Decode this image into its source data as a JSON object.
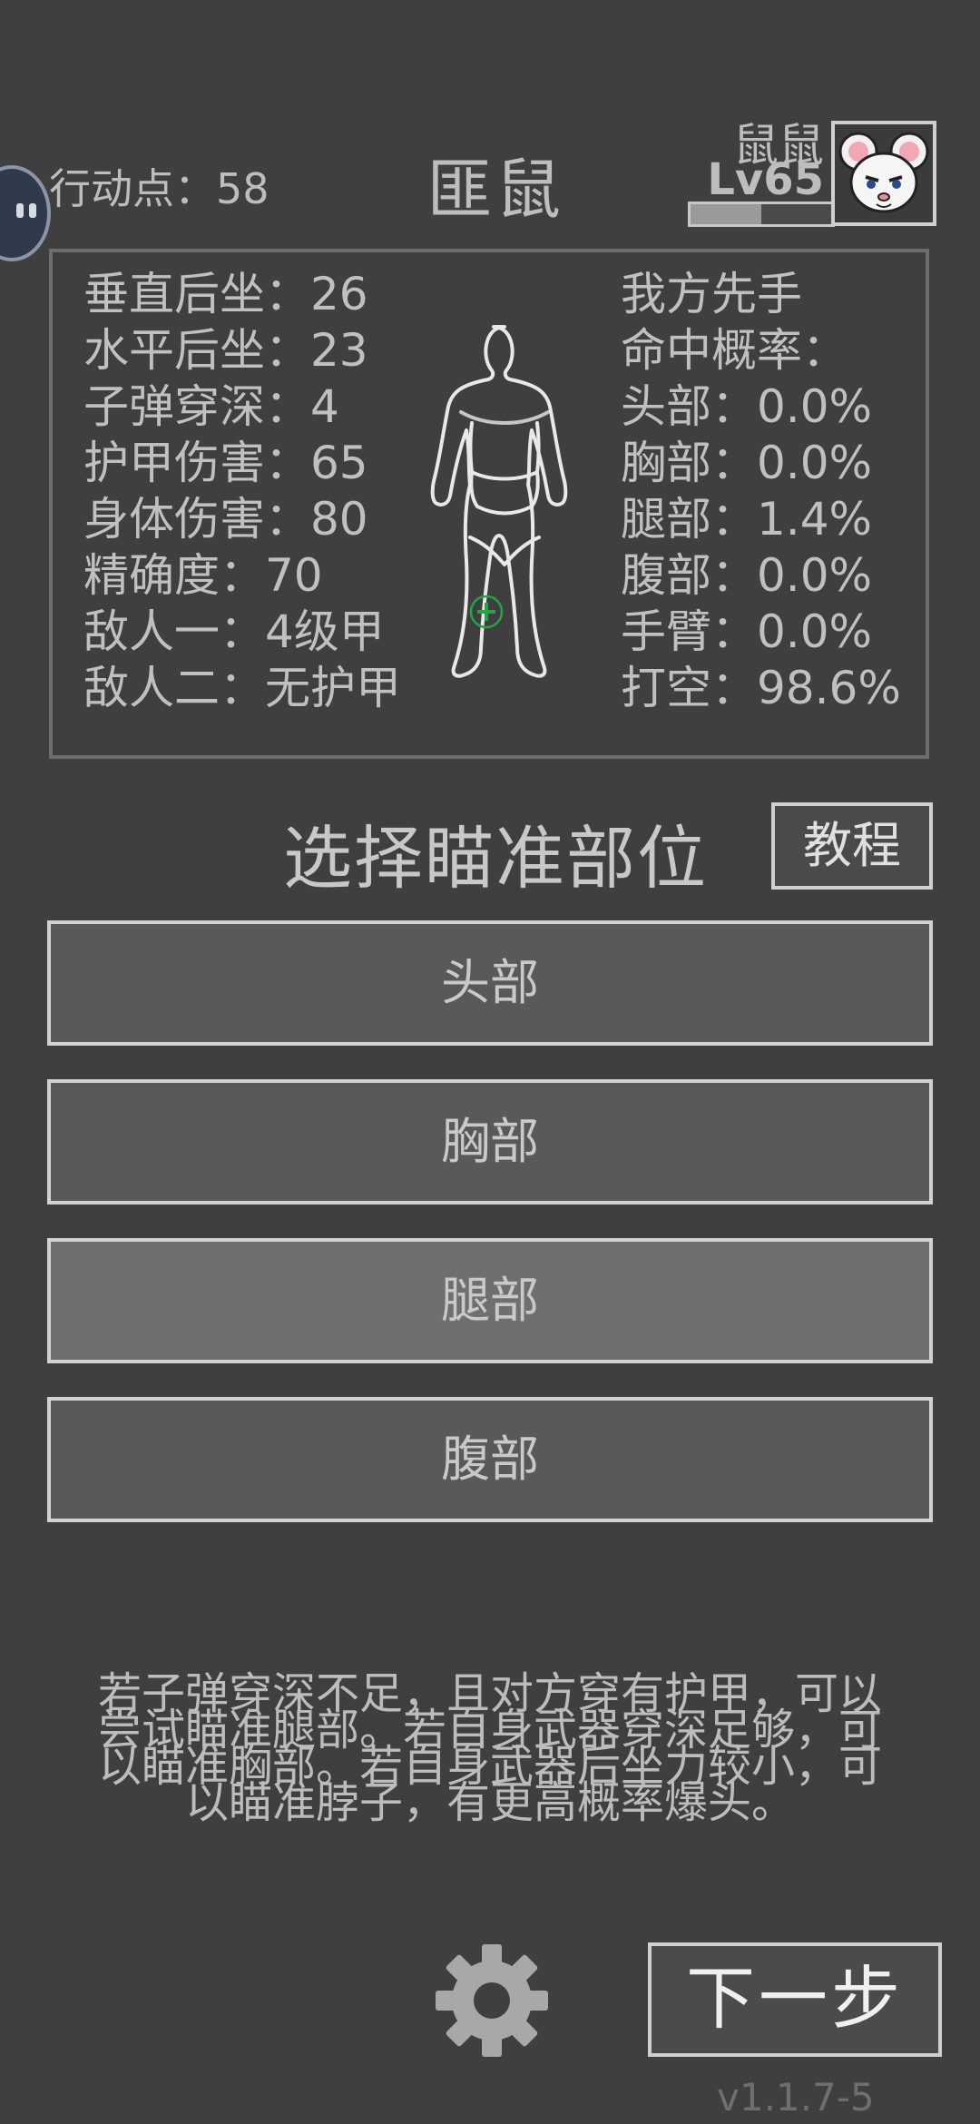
{
  "header": {
    "action_points": "行动点：58",
    "enemy_name": "匪鼠",
    "player_name": "鼠鼠",
    "player_level": "Lv65",
    "xp_fraction": 0.5
  },
  "stats": [
    "垂直后坐：26",
    "水平后坐：23",
    "子弹穿深：4",
    "护甲伤害：65",
    "身体伤害：80",
    "精确度：70",
    "敌人一：4级甲",
    "敌人二：无护甲"
  ],
  "hit_chances": [
    "我方先手",
    "命中概率：",
    "头部：0.0%",
    "胸部：0.0%",
    "腿部：1.4%",
    "腹部：0.0%",
    "手臂：0.0%",
    "打空：98.6%"
  ],
  "aim": {
    "title": "选择瞄准部位",
    "tutorial_label": "教程",
    "parts": [
      "头部",
      "胸部",
      "腿部",
      "腹部"
    ],
    "selected": "腿部"
  },
  "hint": {
    "lines": [
      "若子弹穿深不足，且对方穿有护甲，可以",
      "尝试瞄准腿部。若自身武器穿深足够，可",
      "以瞄准胸部。若自身武器后坐力较小，可",
      "以瞄准脖子，有更高概率爆头。"
    ]
  },
  "footer": {
    "next_label": "下一步",
    "version": "v1.1.7-5"
  },
  "icons": {
    "settings": "gear-icon",
    "avatar": "mouse-avatar-icon",
    "target": "crosshair-icon"
  },
  "colors": {
    "background": "#3f3f3f",
    "button": "#595959",
    "button_active": "#6f6f6f",
    "crosshair": "#22a447"
  }
}
